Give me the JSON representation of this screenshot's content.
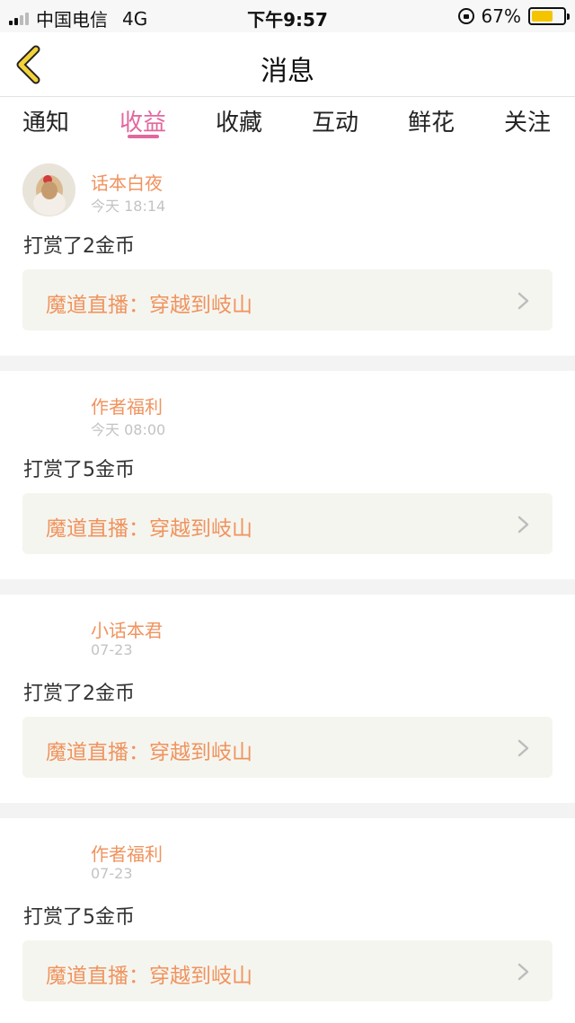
{
  "status_bar": {
    "carrier": "中国电信",
    "network": "4G",
    "time": "下午9:57",
    "battery": "67%",
    "battery_level": 0.67
  },
  "nav": {
    "title": "消息",
    "back_icon": "chevron-left-icon"
  },
  "tabs": [
    {
      "label": "通知",
      "active": false
    },
    {
      "label": "收益",
      "active": true
    },
    {
      "label": "收藏",
      "active": false
    },
    {
      "label": "互动",
      "active": false
    },
    {
      "label": "鲜花",
      "active": false
    },
    {
      "label": "关注",
      "active": false
    }
  ],
  "colors": {
    "accent_pink": "#e2679e",
    "name_orange": "#f0935e",
    "link_bg": "#f5f5ef"
  },
  "messages": [
    {
      "user": "话本白夜",
      "time": "今天 18:14",
      "text": "打赏了2金币",
      "link": "魔道直播：穿越到岐山",
      "has_avatar": true
    },
    {
      "user": "作者福利",
      "time": "今天 08:00",
      "text": "打赏了5金币",
      "link": "魔道直播：穿越到岐山",
      "has_avatar": false
    },
    {
      "user": "小话本君",
      "time": "07-23",
      "text": "打赏了2金币",
      "link": "魔道直播：穿越到岐山",
      "has_avatar": false
    },
    {
      "user": "作者福利",
      "time": "07-23",
      "text": "打赏了5金币",
      "link": "魔道直播：穿越到岐山",
      "has_avatar": false
    }
  ]
}
